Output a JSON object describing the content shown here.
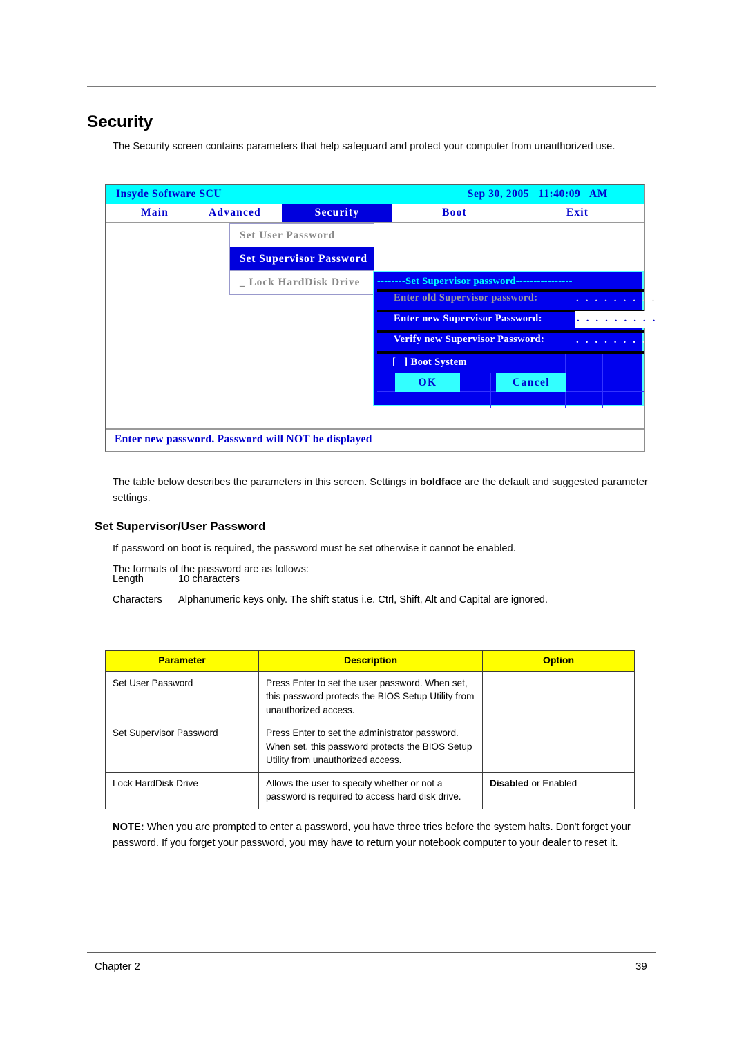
{
  "document": {
    "page_title": "Security",
    "intro_paragraph": "The Security screen contains parameters that help safeguard and protect your computer from unauthorized use.",
    "table_intro_before_bold": "The table below describes the parameters in this screen. Settings in ",
    "table_intro_bold": "boldface",
    "table_intro_after_bold": " are the default and suggested parameter settings.",
    "section_heading": "Set Supervisor/User Password",
    "paragraph_boot": "If password on boot is required, the password must be set otherwise it cannot be enabled.",
    "paragraph_formats": "The formats of the password are as follows:",
    "length_label": "Length",
    "length_value": "10 characters",
    "characters_label": "Characters",
    "characters_value": "Alphanumeric keys only. The shift status i.e. Ctrl, Shift, Alt and Capital are ignored."
  },
  "bios": {
    "app_name": "Insyde Software SCU",
    "clock": "Sep 30, 2005   11:40:09   AM",
    "menu": [
      {
        "label": "Main",
        "active": false
      },
      {
        "label": "Advanced",
        "active": false
      },
      {
        "label": "Security",
        "active": true
      },
      {
        "label": "Boot",
        "active": false
      },
      {
        "label": "Exit",
        "active": false
      }
    ],
    "submenu": [
      {
        "label": "Set User Password",
        "selected": false
      },
      {
        "label": "Set Supervisor Password",
        "selected": true
      },
      {
        "label": "_ Lock HardDisk Drive",
        "selected": false
      }
    ],
    "dialog": {
      "title": "--------Set Supervisor password----------------",
      "old_password_label": "Enter old Supervisor password:",
      "old_password_dots": ". . . . . . . . .",
      "new_password_label": "Enter new Supervisor Password:",
      "new_password_dots": ". . . . . . . . .",
      "verify_password_label": "Verify new Supervisor Password:",
      "verify_password_dots": ". . . . . . . . .",
      "boot_system_label": "[   ] Boot System",
      "ok_label": "OK",
      "cancel_label": "Cancel"
    },
    "status_text": "Enter new password. Password will NOT be displayed",
    "colors": {
      "titlebar": "#00ffff",
      "accent_blue": "#0000cc",
      "dialog_bg": "#0000ee",
      "dialog_border": "#55ffff",
      "button_bg": "#33ffff"
    }
  },
  "param_table": {
    "headers": [
      "Parameter",
      "Description",
      "Option"
    ],
    "rows": [
      {
        "parameter": "Set User Password",
        "description": "Press Enter to set the user password. When set, this password protects the BIOS Setup Utility from unauthorized access.",
        "option_bold": "",
        "option_rest": ""
      },
      {
        "parameter": "Set Supervisor Password",
        "description": "Press Enter to set the administrator password. When set, this password protects the BIOS Setup Utility from unauthorized access.",
        "option_bold": "",
        "option_rest": ""
      },
      {
        "parameter": "Lock HardDisk Drive",
        "description": "Allows the user to specify whether or not a password is required to access hard disk drive.",
        "option_bold": "Disabled",
        "option_rest": " or Enabled"
      }
    ],
    "header_bg": "#ffff00"
  },
  "note": {
    "label": "NOTE:",
    "text": " When you are prompted to enter a password, you have three tries before the system halts. Don't forget your password. If you forget your password, you may have to return your notebook computer to your dealer to reset it."
  },
  "footer": {
    "left": "Chapter 2",
    "right": "39"
  }
}
